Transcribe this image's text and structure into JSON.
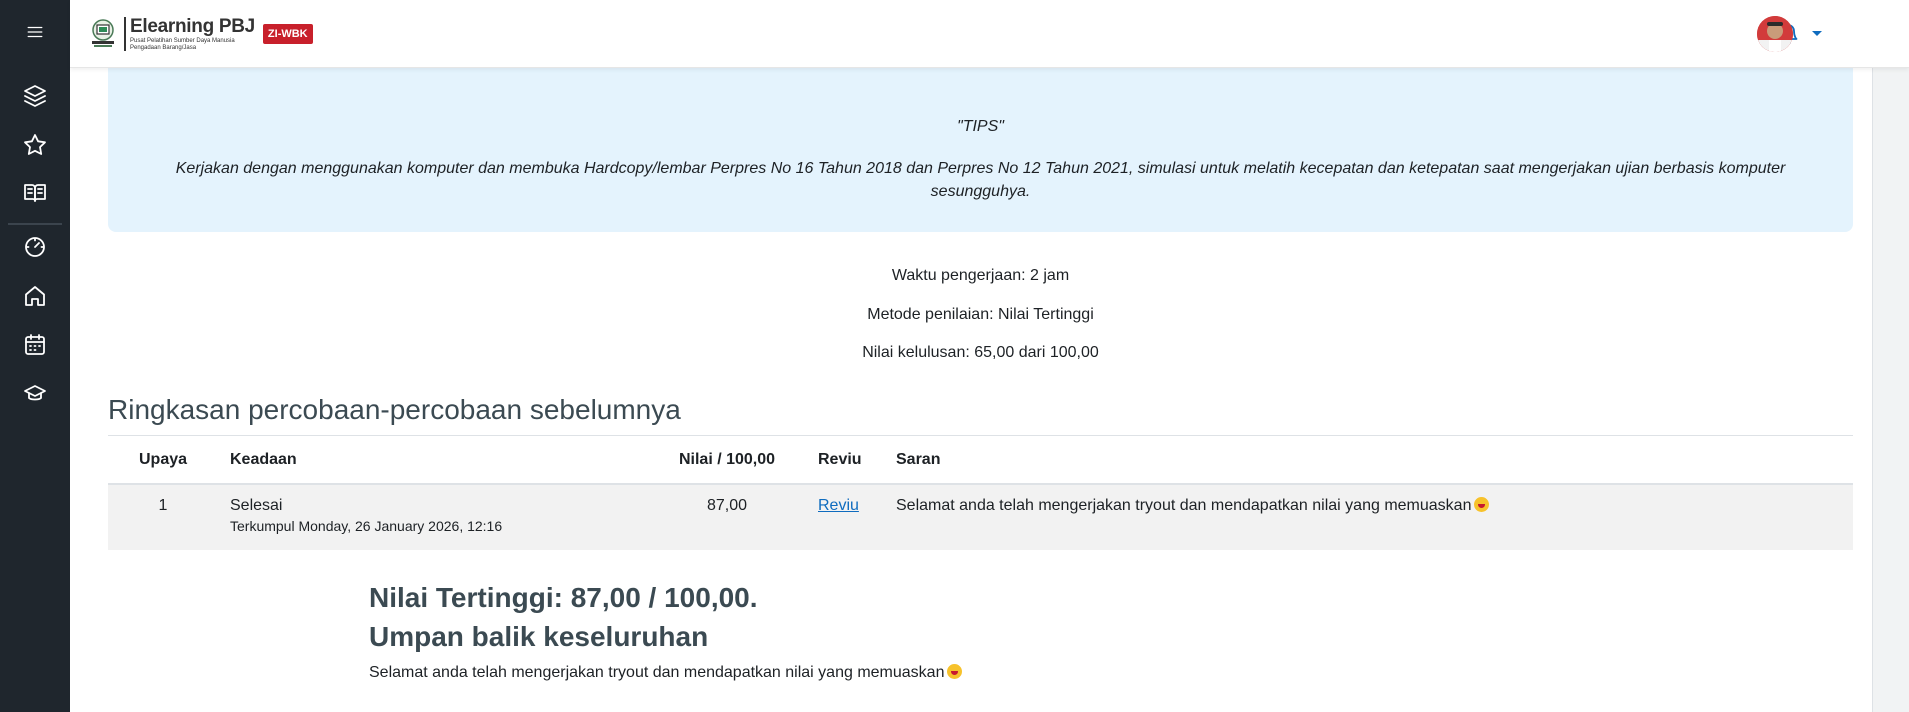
{
  "sidebar": {
    "items": [
      {
        "icon": "menu-icon",
        "name": "sidebar-toggle"
      },
      {
        "icon": "layers-icon",
        "name": "sidebar-item-courses"
      },
      {
        "icon": "star-icon",
        "name": "sidebar-item-starred"
      },
      {
        "icon": "book-open-icon",
        "name": "sidebar-item-library"
      },
      {
        "icon": "gauge-icon",
        "name": "sidebar-item-dashboard"
      },
      {
        "icon": "home-icon",
        "name": "sidebar-item-home"
      },
      {
        "icon": "calendar-icon",
        "name": "sidebar-item-calendar"
      },
      {
        "icon": "graduation-cap-icon",
        "name": "sidebar-item-grades"
      }
    ]
  },
  "header": {
    "brand_title": "Elearning PBJ",
    "brand_subtitle_line1": "Pusat Pelatihan Sumber Daya Manusia",
    "brand_subtitle_line2": "Pengadaan Barang/Jasa",
    "badge": "ZI-WBK",
    "notification_icon": "bell-icon",
    "user_menu_icon": "chevron-down-icon"
  },
  "tips": {
    "title": "\"TIPS\"",
    "body": "Kerjakan dengan menggunakan komputer dan membuka Hardcopy/lembar Perpres No 16 Tahun 2018 dan Perpres No 12 Tahun 2021, simulasi untuk melatih kecepatan dan ketepatan saat mengerjakan ujian berbasis komputer sesungguhya."
  },
  "quiz_info": {
    "time": "Waktu pengerjaan: 2 jam",
    "grading_method": "Metode penilaian: Nilai Tertinggi",
    "passing_grade": "Nilai kelulusan: 65,00 dari 100,00"
  },
  "summary": {
    "title": "Ringkasan percobaan-percobaan sebelumnya",
    "columns": [
      "Upaya",
      "Keadaan",
      "Nilai / 100,00",
      "Reviu",
      "Saran"
    ],
    "rows": [
      {
        "attempt": "1",
        "state": "Selesai",
        "submitted": "Terkumpul Monday, 26 January 2026, 12:16",
        "grade": "87,00",
        "review": "Reviu",
        "feedback": "Selamat anda telah mengerjakan tryout dan mendapatkan nilai yang memuaskan"
      }
    ]
  },
  "result": {
    "highest_grade": "Nilai Tertinggi: 87,00 / 100,00.",
    "feedback_title": "Umpan balik keseluruhan",
    "feedback_text": "Selamat anda telah mengerjakan tryout dan mendapatkan nilai yang memuaskan"
  },
  "colors": {
    "sidebar_bg": "#1f262d",
    "tips_bg": "#e4f3fd",
    "link": "#0f6cbf",
    "badge_bg": "#c8202b"
  }
}
